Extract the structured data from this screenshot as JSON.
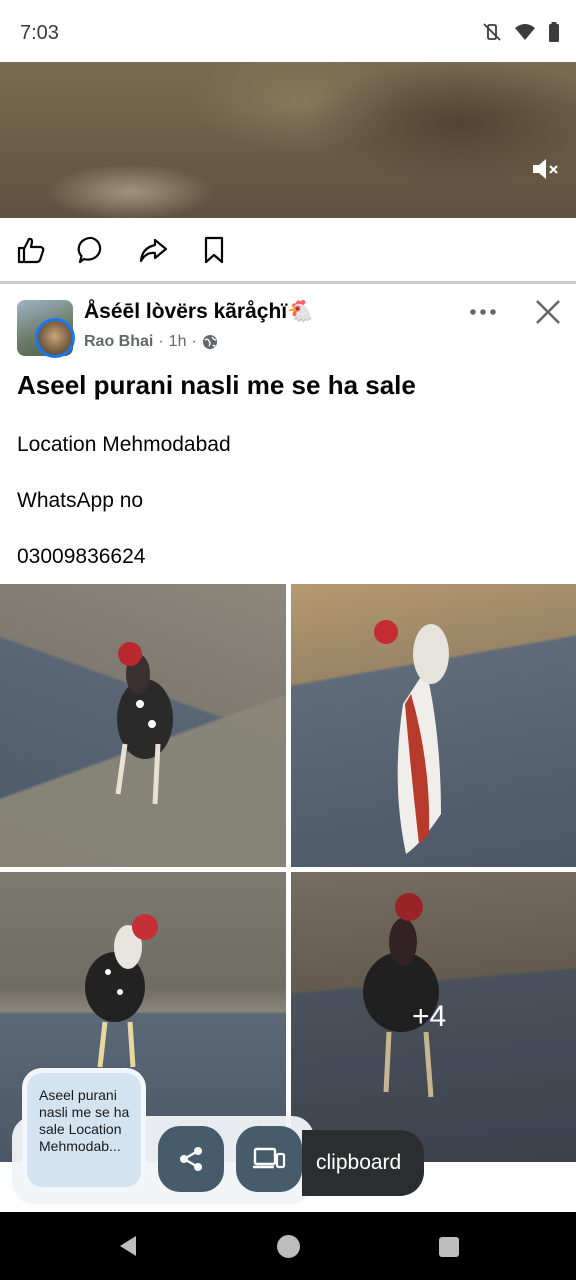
{
  "status_bar": {
    "time": "7:03",
    "icons": [
      "vibrate-off-icon",
      "wifi-icon",
      "battery-icon"
    ]
  },
  "video": {
    "mute_icon": "speaker-muted-icon"
  },
  "actions": [
    "like-icon",
    "comment-icon",
    "share-icon",
    "save-icon"
  ],
  "post": {
    "group_name": "Åséēl lòvërs kãråçhï🐔",
    "author": "Rao Bhai",
    "separator": "·",
    "time": "1h",
    "privacy_icon": "globe-icon",
    "title": "Aseel purani nasli me se ha sale",
    "lines": [
      "Location Mehmodabad",
      "WhatsApp no",
      "03009836624"
    ],
    "more_photos": "+4"
  },
  "share_sheet": {
    "clip_text": "Aseel purani nasli me se ha sale Location Mehmodab...",
    "share_icon": "share-nodes-icon",
    "device_icon": "devices-icon",
    "clipboard_label": "clipboard"
  },
  "colors": {
    "accent": "#1877f2",
    "button": "#475c6b",
    "secondary_text": "#65676b"
  }
}
